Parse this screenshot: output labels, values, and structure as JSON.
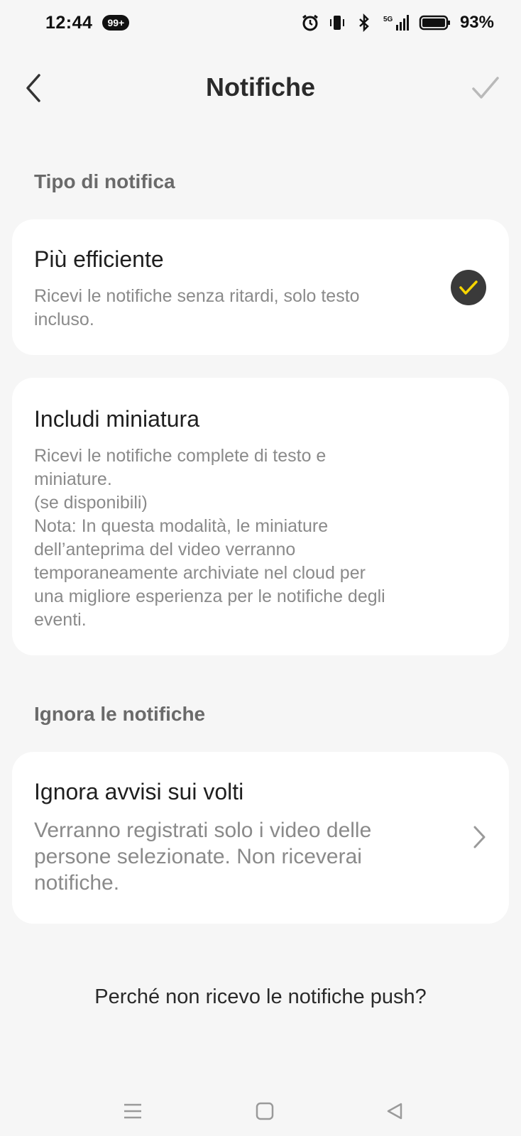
{
  "status_bar": {
    "time": "12:44",
    "notification_badge": "99+",
    "battery": "93%",
    "icons": [
      "alarm-icon",
      "vibrate-icon",
      "bluetooth-icon",
      "5g-signal-icon",
      "battery-icon"
    ]
  },
  "header": {
    "title": "Notifiche",
    "back_icon": "chevron-left-icon",
    "confirm_icon": "check-icon"
  },
  "sections": {
    "notification_type": {
      "title": "Tipo di notifica",
      "options": [
        {
          "title": "Più efficiente",
          "description": "Ricevi le notifiche senza ritardi, solo testo incluso.",
          "selected": true
        },
        {
          "title": "Includi miniatura",
          "description_lines": [
            "Ricevi le notifiche complete di testo e",
            "miniature.",
            "(se disponibili)",
            "Nota: In questa modalità, le miniature",
            "dell’anteprima del video verranno",
            "temporaneamente archiviate nel cloud per",
            "una migliore esperienza per le notifiche degli",
            "eventi."
          ],
          "selected": false
        }
      ]
    },
    "ignore": {
      "title": "Ignora le notifiche",
      "item": {
        "title": "Ignora avvisi sui volti",
        "description_lines": [
          "Verranno registrati solo i video delle",
          "persone selezionate. Non riceverai",
          "notifiche."
        ]
      }
    }
  },
  "help_link": "Perché non ricevo le notifiche push?",
  "colors": {
    "background": "#f6f6f6",
    "card": "#ffffff",
    "selected_check_bg": "#3a3a3a",
    "selected_check_mark": "#f5d400"
  },
  "nav_bar": {
    "icons": [
      "menu-icon",
      "home-square-icon",
      "back-triangle-icon"
    ]
  }
}
